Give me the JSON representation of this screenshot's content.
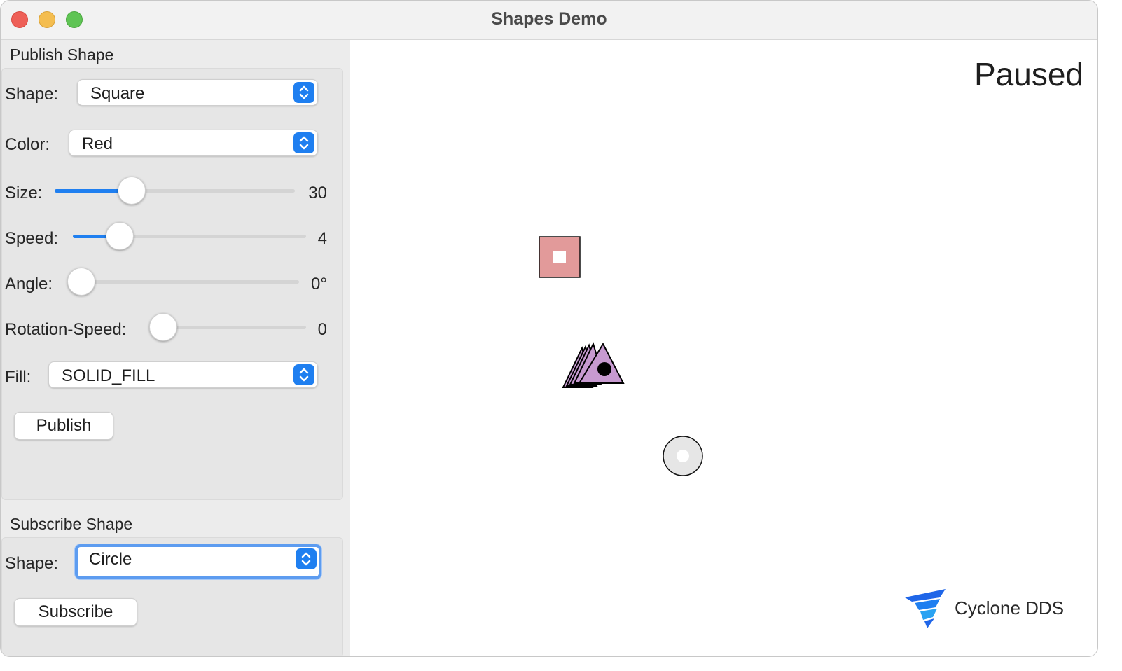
{
  "window": {
    "title": "Shapes Demo"
  },
  "publish": {
    "group_title": "Publish Shape",
    "shape_label": "Shape:",
    "shape_value": "Square",
    "color_label": "Color:",
    "color_value": "Red",
    "size_label": "Size:",
    "size_value": "30",
    "size_fraction": 0.32,
    "speed_label": "Speed:",
    "speed_value": "4",
    "speed_fraction": 0.2,
    "angle_label": "Angle:",
    "angle_value": "0°",
    "angle_fraction": 0.0,
    "rotation_label": "Rotation-Speed:",
    "rotation_value": "0",
    "rotation_fraction": 0.0,
    "fill_label": "Fill:",
    "fill_value": "SOLID_FILL",
    "publish_button": "Publish"
  },
  "subscribe": {
    "group_title": "Subscribe Shape",
    "shape_label": "Shape:",
    "shape_value": "Circle",
    "subscribe_button": "Subscribe"
  },
  "canvas": {
    "status": "Paused",
    "brand": "Cyclone DDS",
    "accent_color": "#1f7ff0",
    "shapes": [
      {
        "type": "square",
        "fill": "#e29a9a"
      },
      {
        "type": "triangle",
        "fill": "#c79ad0"
      },
      {
        "type": "circle",
        "fill": "#e6e6e6"
      }
    ]
  }
}
